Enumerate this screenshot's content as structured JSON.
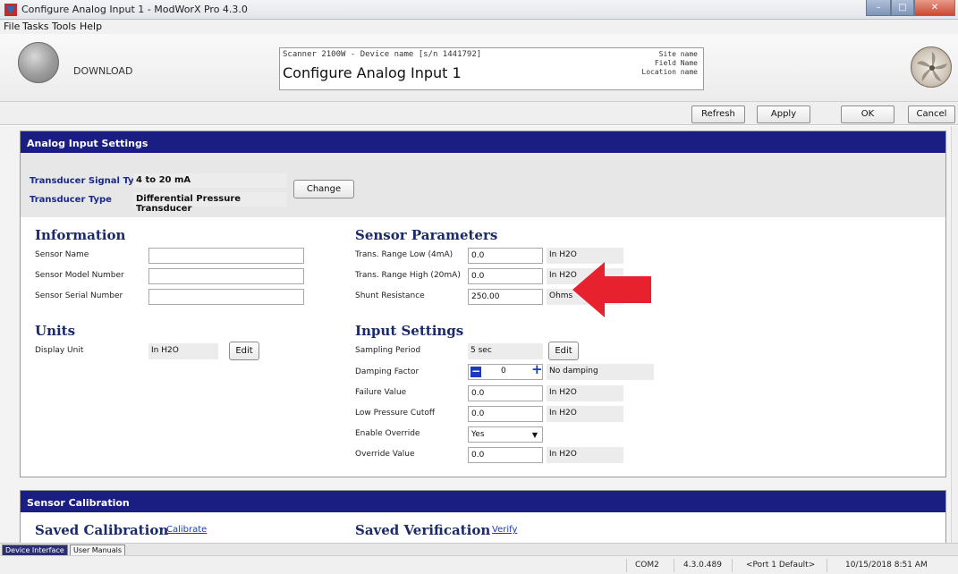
{
  "window": {
    "title": "Configure Analog Input 1 - ModWorX Pro 4.3.0",
    "controls": [
      "–",
      "□",
      "✕"
    ]
  },
  "menu": [
    "File",
    "Tasks",
    "Tools",
    "Help"
  ],
  "header": {
    "download_label": "DOWNLOAD",
    "device_line": "Scanner 2100W - Device name [s/n 1441792]",
    "page_title": "Configure Analog Input 1",
    "site_name": "Site name",
    "field_name": "Field Name",
    "location_name": "Location name"
  },
  "toolbar": {
    "refresh": "Refresh",
    "apply": "Apply",
    "ok": "OK",
    "cancel": "Cancel"
  },
  "analog_panel": {
    "title": "Analog Input Settings",
    "signal_type_label": "Transducer Signal Type",
    "signal_type_value": "4 to 20 mA",
    "transducer_type_label": "Transducer Type",
    "transducer_type_value": "Differential Pressure Transducer",
    "change_button": "Change"
  },
  "information": {
    "title": "Information",
    "sensor_name_label": "Sensor Name",
    "sensor_name_value": "",
    "model_label": "Sensor Model Number",
    "model_value": "",
    "serial_label": "Sensor Serial Number",
    "serial_value": ""
  },
  "units": {
    "title": "Units",
    "display_unit_label": "Display Unit",
    "display_unit_value": "In H2O",
    "edit_button": "Edit"
  },
  "sensor_params": {
    "title": "Sensor Parameters",
    "range_low_label": "Trans. Range Low (4mA)",
    "range_low_value": "0.0",
    "range_low_unit": "In H2O",
    "range_high_label": "Trans. Range High (20mA)",
    "range_high_value": "0.0",
    "range_high_unit": "In H2O",
    "shunt_label": "Shunt Resistance",
    "shunt_value": "250.00",
    "shunt_unit": "Ohms"
  },
  "input_settings": {
    "title": "Input Settings",
    "sampling_label": "Sampling Period",
    "sampling_value": "5 sec",
    "sampling_edit": "Edit",
    "damping_label": "Damping Factor",
    "damping_value": "0",
    "damping_desc": "No damping",
    "failure_label": "Failure Value",
    "failure_value": "0.0",
    "failure_unit": "In H2O",
    "cutoff_label": "Low Pressure Cutoff",
    "cutoff_value": "0.0",
    "cutoff_unit": "In H2O",
    "override_enable_label": "Enable Override",
    "override_enable_value": "Yes",
    "override_value_label": "Override Value",
    "override_value": "0.0",
    "override_unit": "In H2O"
  },
  "calibration_panel": {
    "title": "Sensor Calibration",
    "saved_cal_title": "Saved Calibration",
    "calibrate_link": "Calibrate",
    "saved_ver_title": "Saved Verification",
    "verify_link": "Verify"
  },
  "bottom_tabs": [
    "Device Interface",
    "User Manuals"
  ],
  "status": {
    "port": "COM2",
    "version": "4.3.0.489",
    "port_default": "<Port 1 Default>",
    "datetime": "10/15/2018 8:51 AM"
  },
  "colors": {
    "panel_header": "#1a1e82",
    "arrow": "#e8212f",
    "link": "#1a3ac0"
  }
}
